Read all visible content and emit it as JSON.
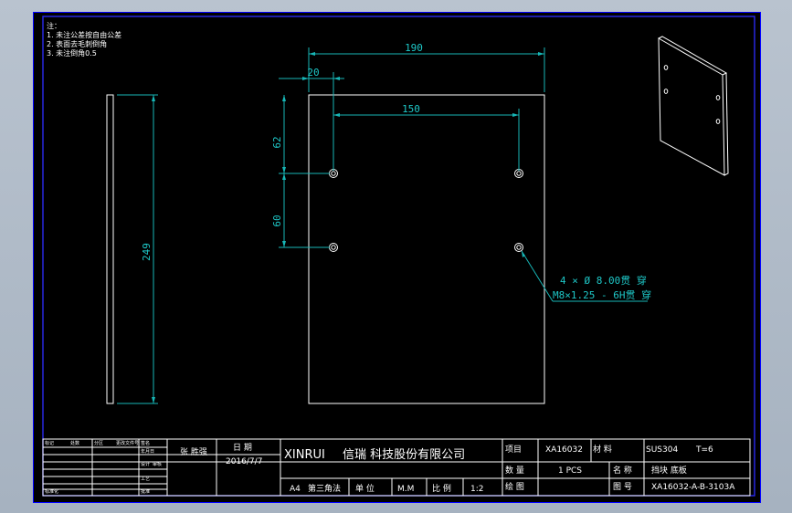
{
  "notes": [
    "注：",
    "1. 未注公差按自由公差",
    "2. 表面去毛刺倒角",
    "3. 未注倒角0.5"
  ],
  "dims": {
    "width": "190",
    "offset_x": "20",
    "hole_span": "150",
    "offset_y": "62",
    "hole_pitch": "60",
    "height": "249",
    "hole_note_1": "4 × Ø  8.00贯 穿",
    "hole_note_2": "M8×1.25 - 6H贯 穿"
  },
  "title_block": {
    "rev_headers": [
      "标记",
      "处数",
      "分区",
      "更改文件号",
      "签名",
      "年月日"
    ],
    "rows_left": [
      "设计",
      "审核",
      "工艺",
      "标准化",
      "批准"
    ],
    "designer": "张 胜强",
    "date_label": "日 期",
    "date": "2016/7/7",
    "company_en": "XINRUI",
    "company_cn": "信瑞 科技股份有限公司",
    "paper": "A4",
    "angle": "第三角法",
    "unit_label": "单 位",
    "unit": "M.M",
    "scale_label": "比 例",
    "scale": "1:2",
    "project_label": "项目",
    "project": "XA16032",
    "material_label": "材 料",
    "material": "SUS304",
    "thickness": "T=6",
    "qty_label": "数 量",
    "qty": "1  PCS",
    "name_label": "名 称",
    "name": "挡块 底板",
    "drawer_label": "绘 图",
    "drawing_no_label": "图 号",
    "drawing_no": "XA16032-A-B-3103A"
  }
}
